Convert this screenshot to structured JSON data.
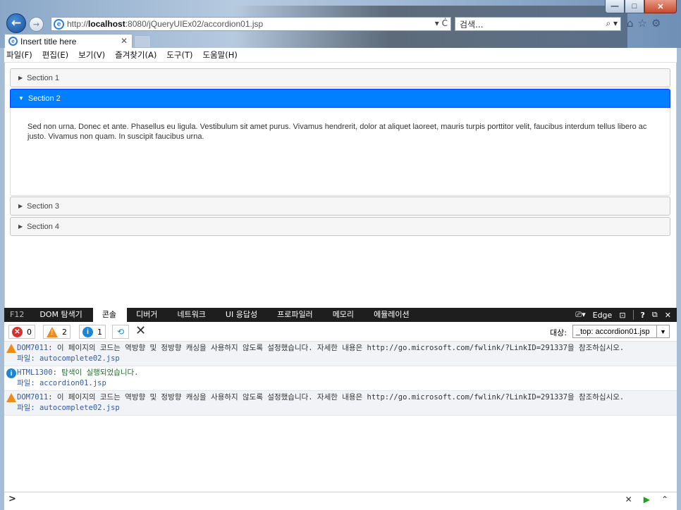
{
  "window": {
    "controls": {
      "minimize": "—",
      "maximize": "□",
      "close": "✕"
    }
  },
  "navigation": {
    "back_icon": "←",
    "forward_icon": "→",
    "address_prefix": "http://",
    "address_host": "localhost",
    "address_rest": ":8080/jQueryUIEx02/accordion01.jsp",
    "address_tools": "▾ Ċ",
    "search_placeholder": "검색...",
    "search_icon": "⌕ ▾",
    "toolbar_icons": {
      "home": "⌂",
      "favorites": "☆",
      "settings": "⚙"
    }
  },
  "tab": {
    "title": "Insert title here",
    "close": "✕"
  },
  "menu": [
    "파일(F)",
    "편집(E)",
    "보기(V)",
    "즐겨찾기(A)",
    "도구(T)",
    "도움말(H)"
  ],
  "accordion": {
    "sections": [
      {
        "label": "Section 1",
        "arrow": "▶",
        "active": false
      },
      {
        "label": "Section 2",
        "arrow": "▼",
        "active": true
      },
      {
        "label": "Section 3",
        "arrow": "▶",
        "active": false
      },
      {
        "label": "Section 4",
        "arrow": "▶",
        "active": false
      }
    ],
    "active_panel_text": "Sed non urna. Donec et ante. Phasellus eu ligula. Vestibulum sit amet purus. Vivamus hendrerit, dolor at aliquet laoreet, mauris turpis porttitor velit, faucibus interdum tellus libero ac justo. Vivamus non quam. In suscipit faucibus urna.",
    "colors": {
      "active_bg": "#007fff",
      "header_bg": "#f6f6f6"
    }
  },
  "devtools": {
    "tabs": [
      "F12",
      "DOM 탐색기",
      "콘솔",
      "디버거",
      "네트워크",
      "UI 응답성",
      "프로파일러",
      "메모리",
      "에뮬레이션"
    ],
    "active_tab": "콘솔",
    "right": {
      "emulation": "Edge",
      "emulation_icon": "⎚▾",
      "console_icon": "⊡",
      "help": "?",
      "undock": "⧉",
      "close": "✕"
    },
    "counts": {
      "errors": "0",
      "warnings": "2",
      "info": "1"
    },
    "clear_icon": "✕",
    "target_label": "대상:",
    "target_value": "_top: accordion01.jsp",
    "target_dropdown": "▼",
    "messages": [
      {
        "type": "warning",
        "code": "DOM7011",
        "text": ": 이 페이지의 코드는 역방향 및 정방향 캐싱을 사용하지 않도록 설정했습니다. 자세한 내용은 http://go.microsoft.com/fwlink/?LinkID=291337을 참조하십시오.",
        "file": "파일: autocomplete02.jsp"
      },
      {
        "type": "info",
        "code": "HTML1300",
        "text": ": 탐색이 실행되었습니다.",
        "file": "파일: accordion01.jsp"
      },
      {
        "type": "warning",
        "code": "DOM7011",
        "text": ": 이 페이지의 코드는 역방향 및 정방향 캐싱을 사용하지 않도록 설정했습니다. 자세한 내용은 http://go.microsoft.com/fwlink/?LinkID=291337을 참조하십시오.",
        "file": "파일: autocomplete02.jsp"
      }
    ],
    "command_prompt": ">",
    "command_buttons": {
      "clear": "✕",
      "run": "▶",
      "expand": "⌃"
    }
  }
}
